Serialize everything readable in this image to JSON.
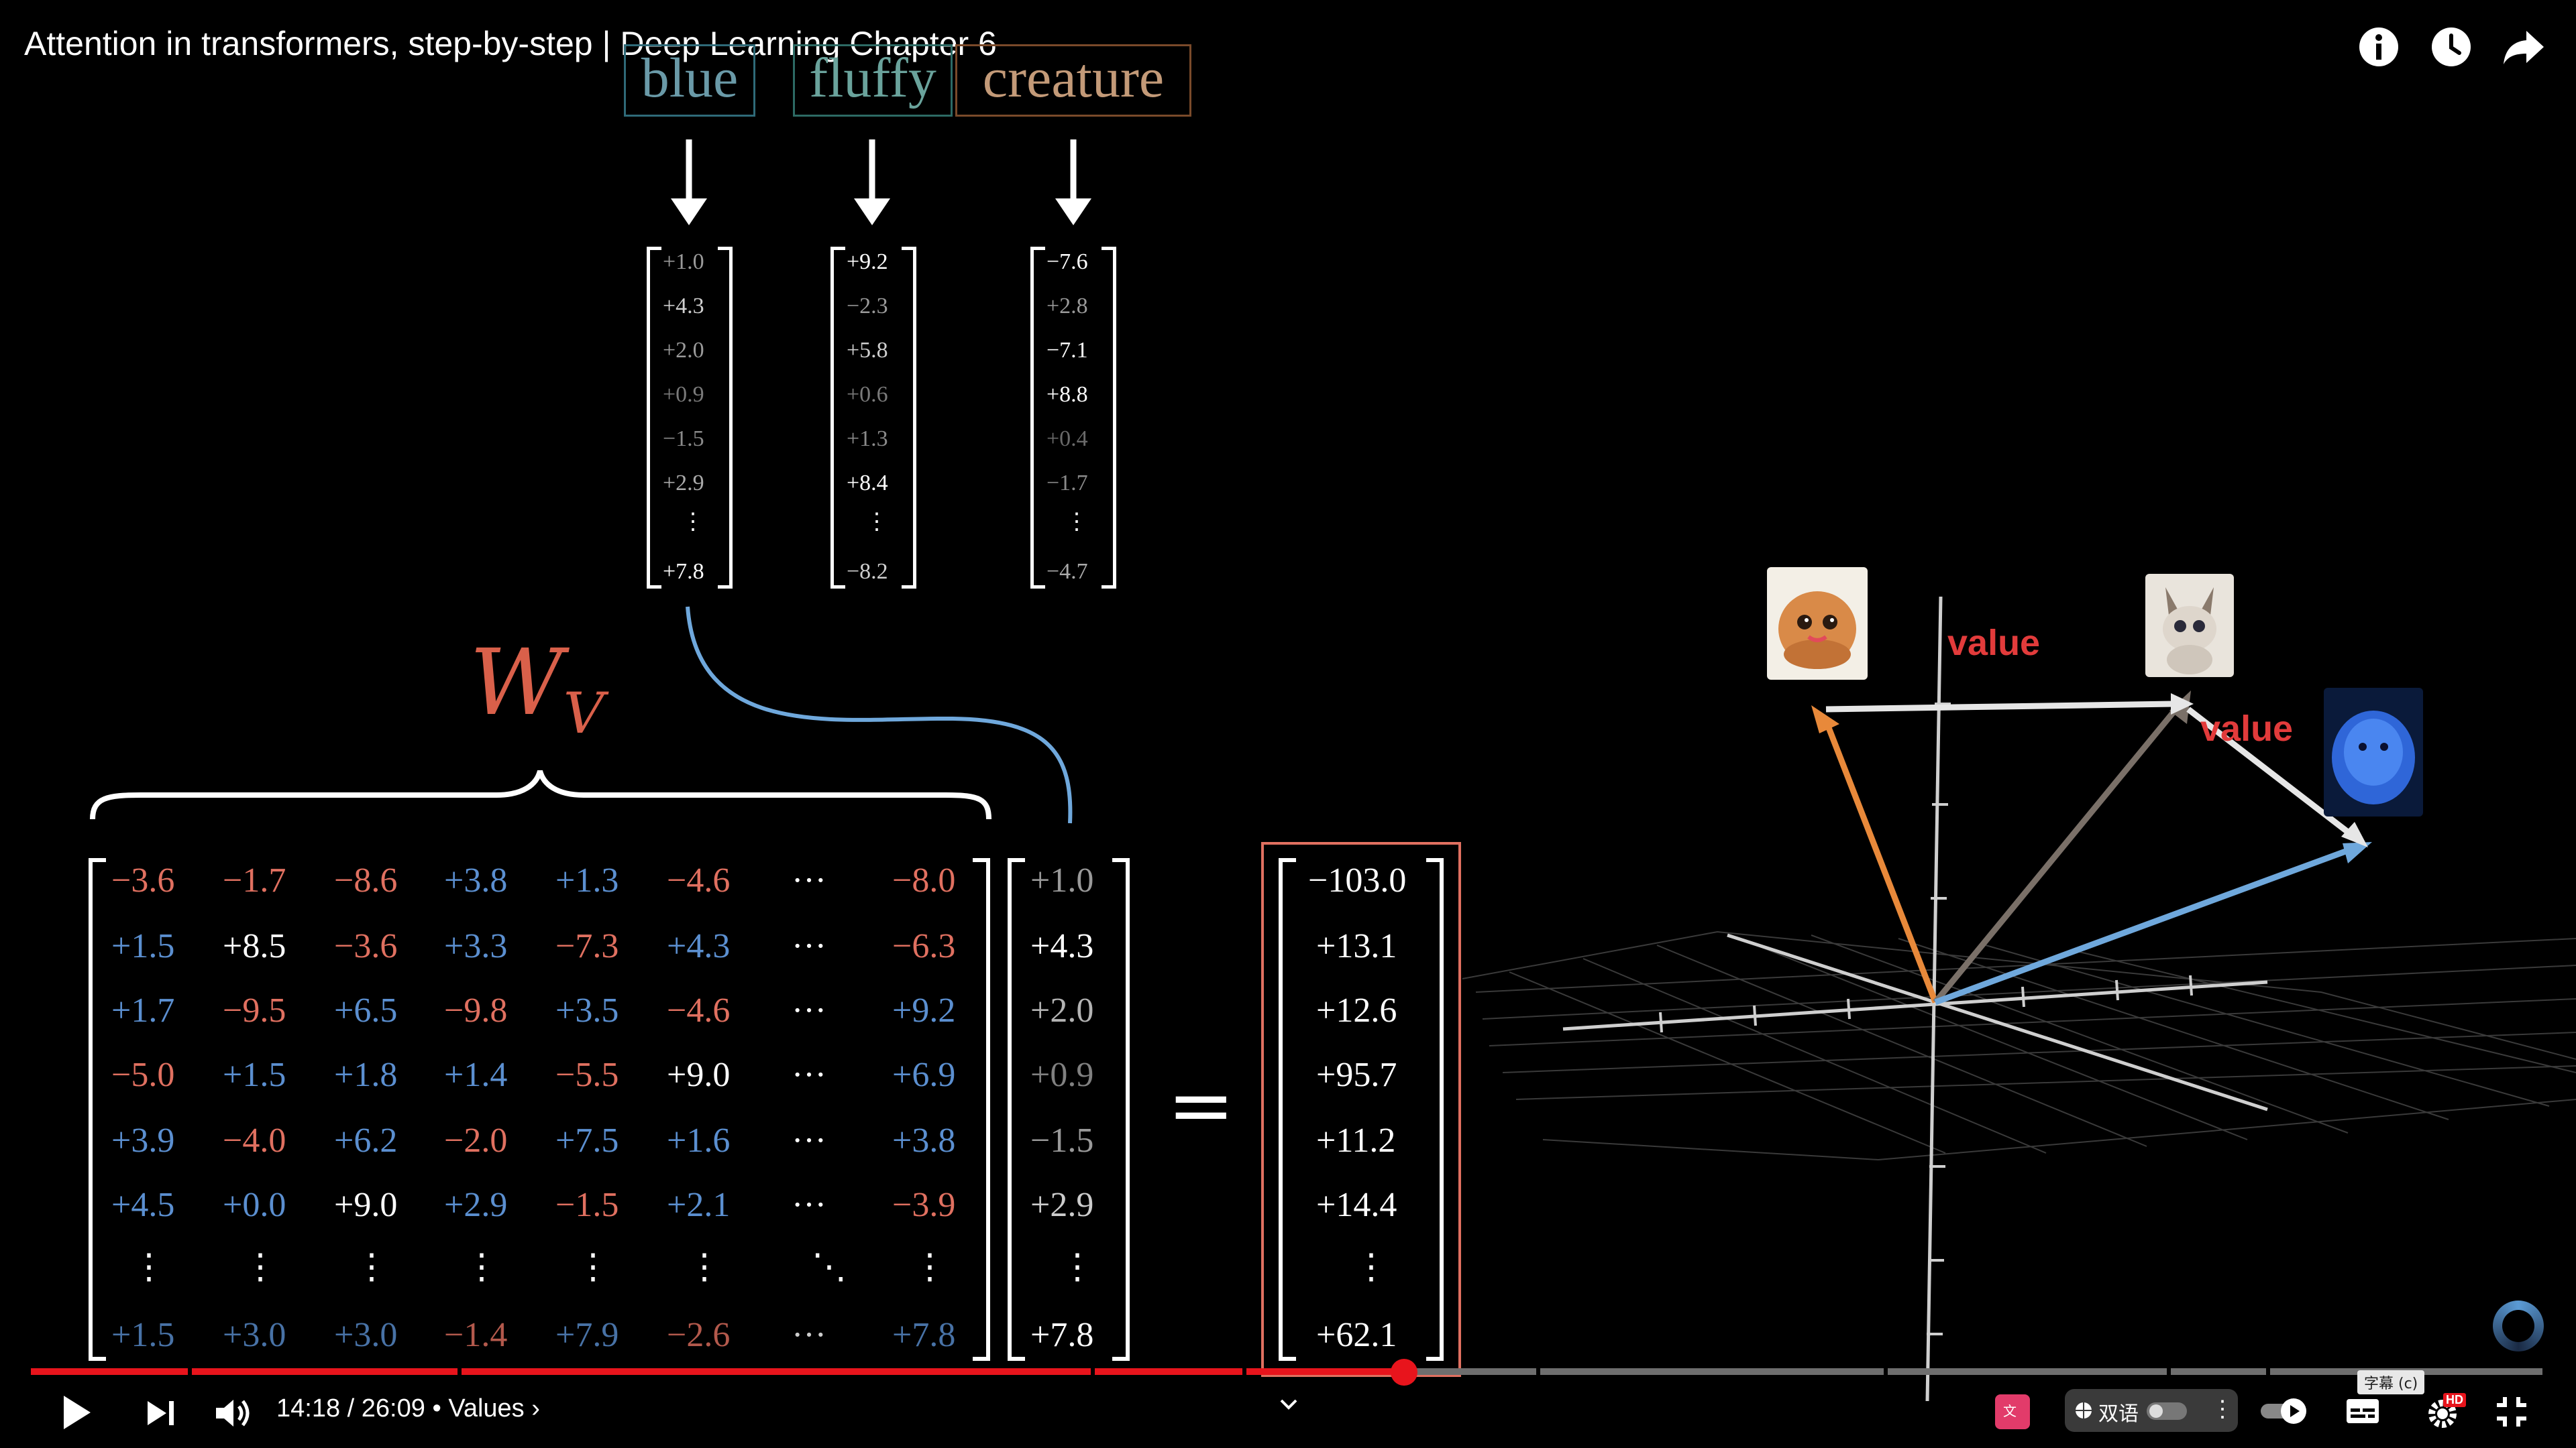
{
  "video": {
    "title": "Attention in transformers, step-by-step | Deep Learning Chapter 6",
    "current_time": "14:18",
    "duration": "26:09",
    "chapter": "Values",
    "progress": 0.5467
  },
  "scene": {
    "words": [
      {
        "text": "blue",
        "color": "#3d7a8a"
      },
      {
        "text": "fluffy",
        "color": "#3d7a74"
      },
      {
        "text": "creature",
        "color": "#8a5a38"
      }
    ],
    "word_vectors": [
      [
        "+1.0",
        "+4.3",
        "+2.0",
        "+0.9",
        "−1.5",
        "+2.9",
        "⋮",
        "+7.8"
      ],
      [
        "+9.2",
        "−2.3",
        "+5.8",
        "+0.6",
        "+1.3",
        "+8.4",
        "⋮",
        "−8.2"
      ],
      [
        "−7.6",
        "+2.8",
        "−7.1",
        "+8.8",
        "+0.4",
        "−1.7",
        "⋮",
        "−4.7"
      ]
    ],
    "matrix_label": "W",
    "matrix_subscript": "V",
    "matrix_rows": [
      [
        "−3.6",
        "−1.7",
        "−8.6",
        "+3.8",
        "+1.3",
        "−4.6",
        "···",
        "−8.0"
      ],
      [
        "+1.5",
        "+8.5",
        "−3.6",
        "+3.3",
        "−7.3",
        "+4.3",
        "···",
        "−6.3"
      ],
      [
        "+1.7",
        "−9.5",
        "+6.5",
        "−9.8",
        "+3.5",
        "−4.6",
        "···",
        "+9.2"
      ],
      [
        "−5.0",
        "+1.5",
        "+1.8",
        "+1.4",
        "−5.5",
        "+9.0",
        "···",
        "+6.9"
      ],
      [
        "+3.9",
        "−4.0",
        "+6.2",
        "−2.0",
        "+7.5",
        "+1.6",
        "···",
        "+3.8"
      ],
      [
        "+4.5",
        "+0.0",
        "+9.0",
        "+2.9",
        "−1.5",
        "+2.1",
        "···",
        "−3.9"
      ],
      [
        "⋮",
        "⋮",
        "⋮",
        "⋮",
        "⋮",
        "⋮",
        "⋱",
        "⋮"
      ],
      [
        "+1.5",
        "+3.0",
        "+3.0",
        "−1.4",
        "+7.9",
        "−2.6",
        "···",
        "+7.8"
      ]
    ],
    "input_vector": [
      "+1.0",
      "+4.3",
      "+2.0",
      "+0.9",
      "−1.5",
      "+2.9",
      "⋮",
      "+7.8"
    ],
    "equals": "=",
    "result_vector": [
      "−103.0",
      "+13.1",
      "+12.6",
      "+95.7",
      "+11.2",
      "+14.4",
      "⋮",
      "+62.1"
    ],
    "value_label_1": "value",
    "value_label_2": "value"
  },
  "controls": {
    "subtitle_label": "双语",
    "subtitle_tooltip": "字幕 (c)",
    "hd_badge": "HD"
  },
  "colors": {
    "negative": "#e07060",
    "positive": "#5b8fd0",
    "neutral": "#ffffff",
    "progress": "#e8141c",
    "value_label": "#e23b3b",
    "result_box": "#e07060",
    "curve": "#6fa8dc"
  }
}
